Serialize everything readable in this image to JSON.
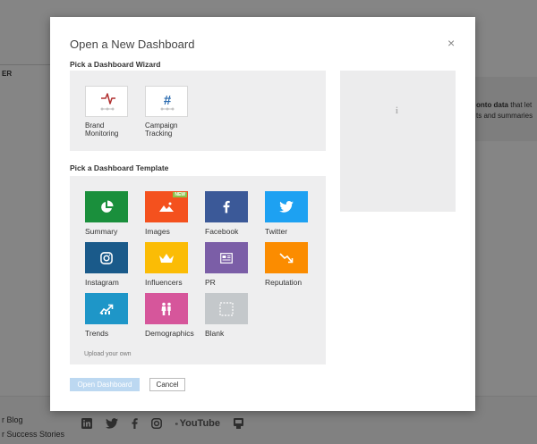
{
  "background": {
    "header_label": "ER",
    "card_line1_bold": "onto data",
    "card_line1_rest": " that let",
    "card_line2": "ts and summaries",
    "footer_links": [
      "r Blog",
      "r Success Stories"
    ],
    "social_icons": [
      "linkedin-icon",
      "twitter-icon",
      "facebook-icon",
      "instagram-icon",
      "youtube-icon",
      "rss-icon"
    ],
    "youtube_text": "YouTube"
  },
  "modal": {
    "title": "Open a New Dashboard",
    "close_symbol": "×",
    "wizard_section_label": "Pick a Dashboard Wizard",
    "wizards": [
      {
        "label": "Brand Monitoring",
        "icon": "pulse-icon"
      },
      {
        "label": "Campaign Tracking",
        "icon": "hashtag-icon"
      }
    ],
    "template_section_label": "Pick a Dashboard Template",
    "templates": [
      {
        "label": "Summary",
        "icon": "pie-chart-icon",
        "color": "#1a8f3c"
      },
      {
        "label": "Images",
        "icon": "image-icon",
        "color": "#f4511e",
        "badge": "NEW"
      },
      {
        "label": "Facebook",
        "icon": "facebook-icon",
        "color": "#3b5998"
      },
      {
        "label": "Twitter",
        "icon": "twitter-icon",
        "color": "#1da1f2"
      },
      {
        "label": "Instagram",
        "icon": "instagram-icon",
        "color": "#1a5a8a"
      },
      {
        "label": "Influencers",
        "icon": "crown-icon",
        "color": "#fbbc05"
      },
      {
        "label": "PR",
        "icon": "newspaper-icon",
        "color": "#7b5ea7"
      },
      {
        "label": "Reputation",
        "icon": "trend-down-icon",
        "color": "#fb8c00"
      },
      {
        "label": "Trends",
        "icon": "trend-up-icon",
        "color": "#1e96c8"
      },
      {
        "label": "Demographics",
        "icon": "people-icon",
        "color": "#d6569b"
      },
      {
        "label": "Blank",
        "icon": "blank-icon",
        "color": "#c4c8cb"
      }
    ],
    "upload_label": "Upload your own",
    "preview_icon": "i",
    "open_button": "Open Dashboard",
    "cancel_button": "Cancel"
  }
}
